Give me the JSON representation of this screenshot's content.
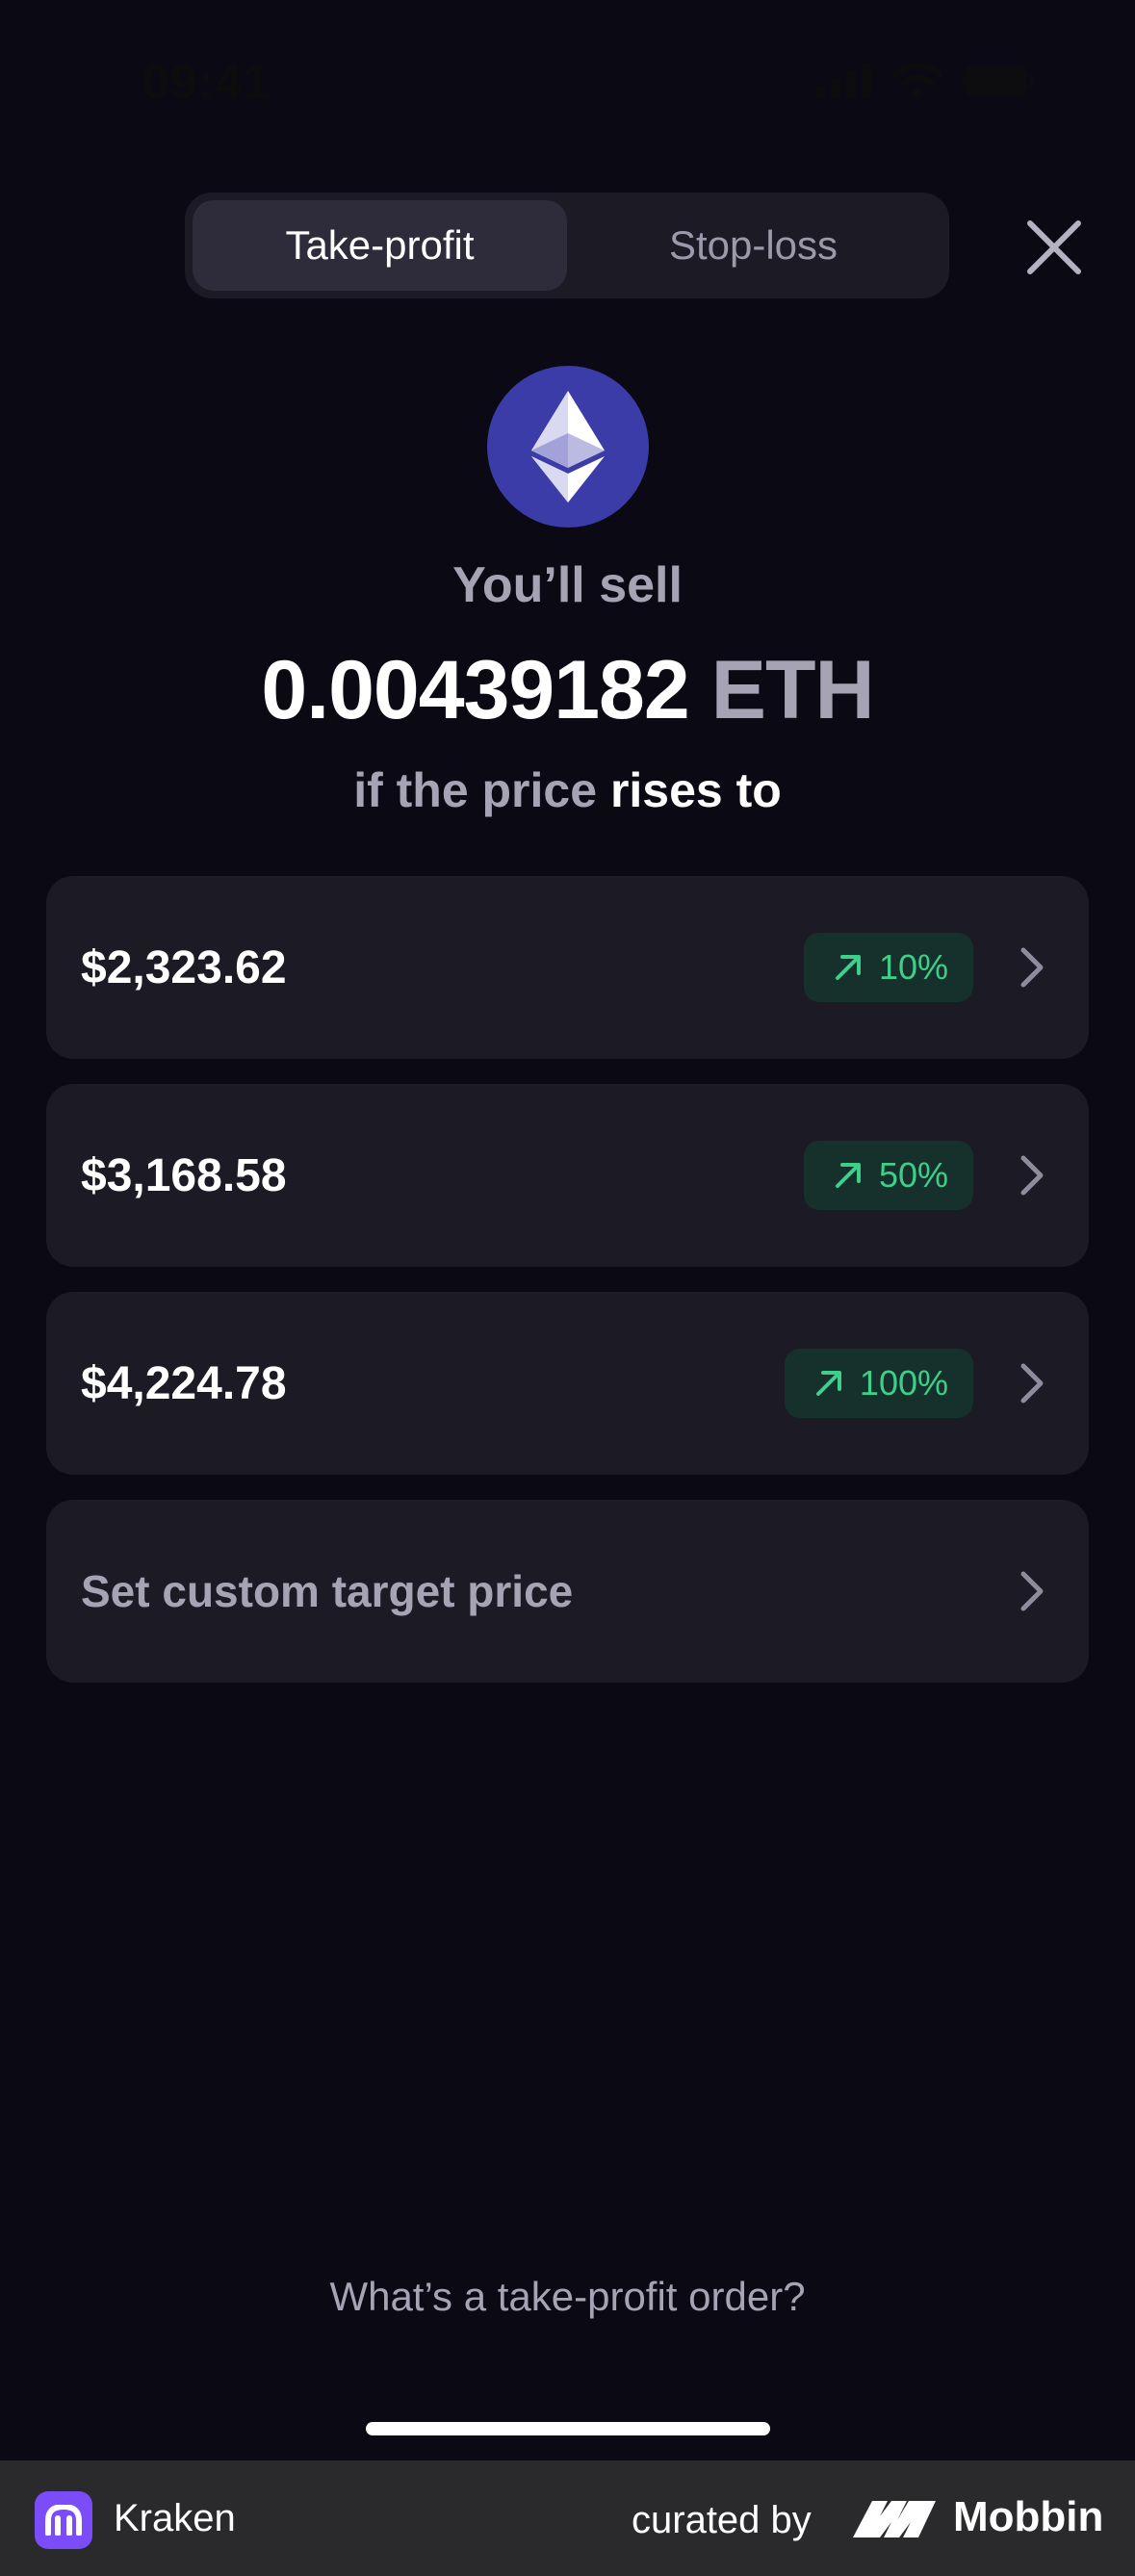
{
  "status_bar": {
    "time": "09:41"
  },
  "tabs": [
    {
      "label": "Take-profit",
      "active": true
    },
    {
      "label": "Stop-loss",
      "active": false
    }
  ],
  "icons": {
    "close": "close-icon",
    "asset": "ethereum-icon",
    "arrow": "arrow-up-right-icon",
    "chevron": "chevron-right-icon"
  },
  "summary": {
    "sell_label": "You’ll sell",
    "amount": "0.00439182",
    "unit": "ETH",
    "condition_prefix": "if the price",
    "condition_emphasis": "rises to"
  },
  "options": [
    {
      "price": "$2,323.62",
      "change": "10%"
    },
    {
      "price": "$3,168.58",
      "change": "50%"
    },
    {
      "price": "$4,224.78",
      "change": "100%"
    }
  ],
  "custom_option": {
    "label": "Set custom target price"
  },
  "help_link": "What’s a take-profit order?",
  "footer": {
    "app_name": "Kraken",
    "curated_by": "curated by",
    "brand": "Mobbin"
  },
  "colors": {
    "background": "#0b0a14",
    "card": "#1b1a25",
    "accent_green": "#3ecf8a",
    "eth_circle": "#3c3ca8",
    "kraken_purple": "#7b4dfa"
  }
}
